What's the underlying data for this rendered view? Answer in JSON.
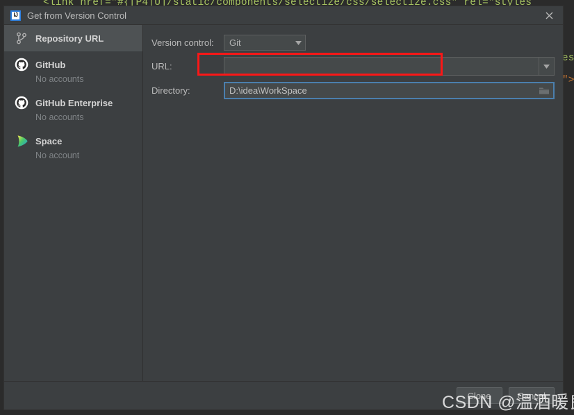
{
  "backdrop": {
    "code_top": "<link href=\"#{[P4|U]/static/components/selectize/css/selectize.css\" rel=\"styles",
    "code_right_1": "\"",
    "code_right_2": "les",
    "code_right_3": ".\">",
    "code_top_tail": "es",
    "colors": {
      "editor_bg": "#2b2b2b",
      "string": "#a5c261",
      "tag": "#e8bf6a",
      "punctuation": "#cc7832",
      "plain": "#a9b7c6"
    }
  },
  "dialog": {
    "title": "Get from Version Control",
    "app_icon_text": "IJ",
    "close_icon": "close-icon"
  },
  "sidebar": {
    "items": [
      {
        "label": "Repository URL",
        "sub": "",
        "icon": "git-branch-icon",
        "selected": true
      },
      {
        "label": "GitHub",
        "sub": "No accounts",
        "icon": "github-icon",
        "selected": false
      },
      {
        "label": "GitHub Enterprise",
        "sub": "No accounts",
        "icon": "github-icon",
        "selected": false
      },
      {
        "label": "Space",
        "sub": "No account",
        "icon": "jetbrains-space-icon",
        "selected": false
      }
    ]
  },
  "form": {
    "version_control": {
      "label": "Version control:",
      "value": "Git",
      "options": [
        "Git"
      ],
      "arrow_icon": "chevron-down-icon"
    },
    "url": {
      "label": "URL:",
      "value": "",
      "placeholder": "",
      "arrow_icon": "chevron-down-icon",
      "highlight_color": "#fb1717"
    },
    "directory": {
      "label": "Directory:",
      "value": "D:\\idea\\WorkSpace",
      "browse_icon": "folder-icon",
      "focus_color": "#4b7fad"
    }
  },
  "footer": {
    "clone_label": "Clone",
    "cancel_label": "Cancel"
  },
  "watermark": {
    "text": "CSDN @温酒暖良人"
  }
}
